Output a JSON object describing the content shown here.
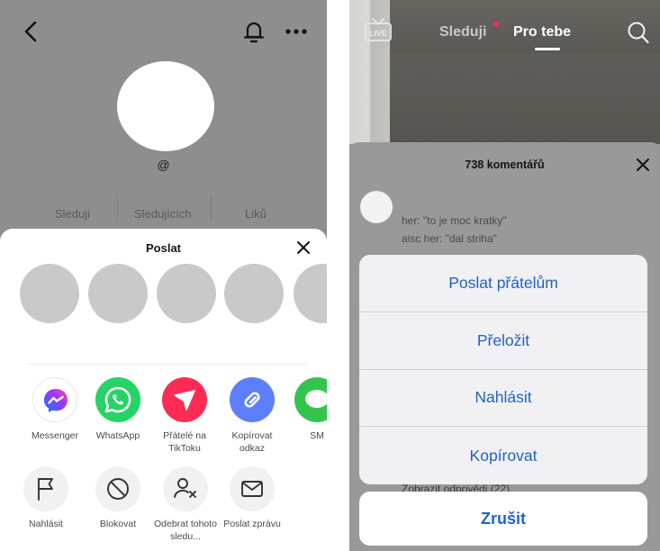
{
  "profile": {
    "handle": "@",
    "stats": [
      "Sleduji",
      "Sledujících",
      "Liků"
    ]
  },
  "share_sheet": {
    "title": "Poslat",
    "share_apps": [
      {
        "label": "Messenger",
        "icon": "messenger-icon",
        "color": "#ffffff"
      },
      {
        "label": "WhatsApp",
        "icon": "whatsapp-icon",
        "color": "#25d366"
      },
      {
        "label": "Přátelé na TikToku",
        "icon": "send-icon",
        "color": "#fe2c55"
      },
      {
        "label": "Kopírovat odkaz",
        "icon": "link-icon",
        "color": "#5b7fff"
      },
      {
        "label": "SM",
        "icon": "sms-icon",
        "color": "#33c54b"
      }
    ],
    "actions": [
      {
        "label": "Nahlásit",
        "icon": "flag-icon"
      },
      {
        "label": "Blokovat",
        "icon": "block-icon"
      },
      {
        "label": "Odebrat tohoto sledu...",
        "icon": "remove-follower-icon"
      },
      {
        "label": "Poslat zprávu",
        "icon": "message-icon"
      }
    ]
  },
  "feed": {
    "tabs": [
      "Sleduji",
      "Pro tebe"
    ],
    "active_tab": "Pro tebe",
    "live_label": "LIVE"
  },
  "comments": {
    "title": "738 komentářů",
    "lines": [
      "her: \"to je moc kratky\"",
      "aisc her: \"dal striha\""
    ],
    "replies": "Zobrazit odpovědi (22)"
  },
  "action_menu": {
    "items": [
      "Poslat přátelům",
      "Přeložit",
      "Nahlásit",
      "Kopírovat"
    ],
    "cancel": "Zrušit"
  },
  "colors": {
    "ios_blue": "#1f63c6",
    "tiktok_red": "#fe2c55"
  }
}
